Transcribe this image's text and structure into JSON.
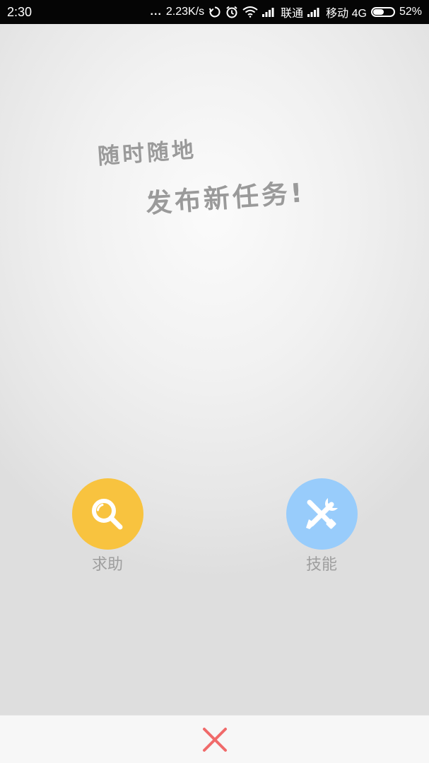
{
  "status_bar": {
    "time": "2:30",
    "more_dots": "...",
    "network_speed": "2.23K/s",
    "carrier1": "联通",
    "carrier2": "移动 4G",
    "battery_percent": "52%",
    "battery_level": 0.52,
    "icons": [
      "sync-icon",
      "alarm-icon",
      "wifi-icon",
      "signal-icon",
      "signal-icon",
      "battery-icon"
    ]
  },
  "slogan": {
    "line1": "随时随地",
    "line2": "发布新任务!"
  },
  "actions": {
    "help": {
      "label": "求助",
      "icon": "search-icon",
      "color": "#f8c33f"
    },
    "skill": {
      "label": "技能",
      "icon": "tools-icon",
      "color": "#98ccfb"
    }
  },
  "bottom": {
    "close_icon": "close-icon",
    "close_color": "#f06a6a"
  }
}
